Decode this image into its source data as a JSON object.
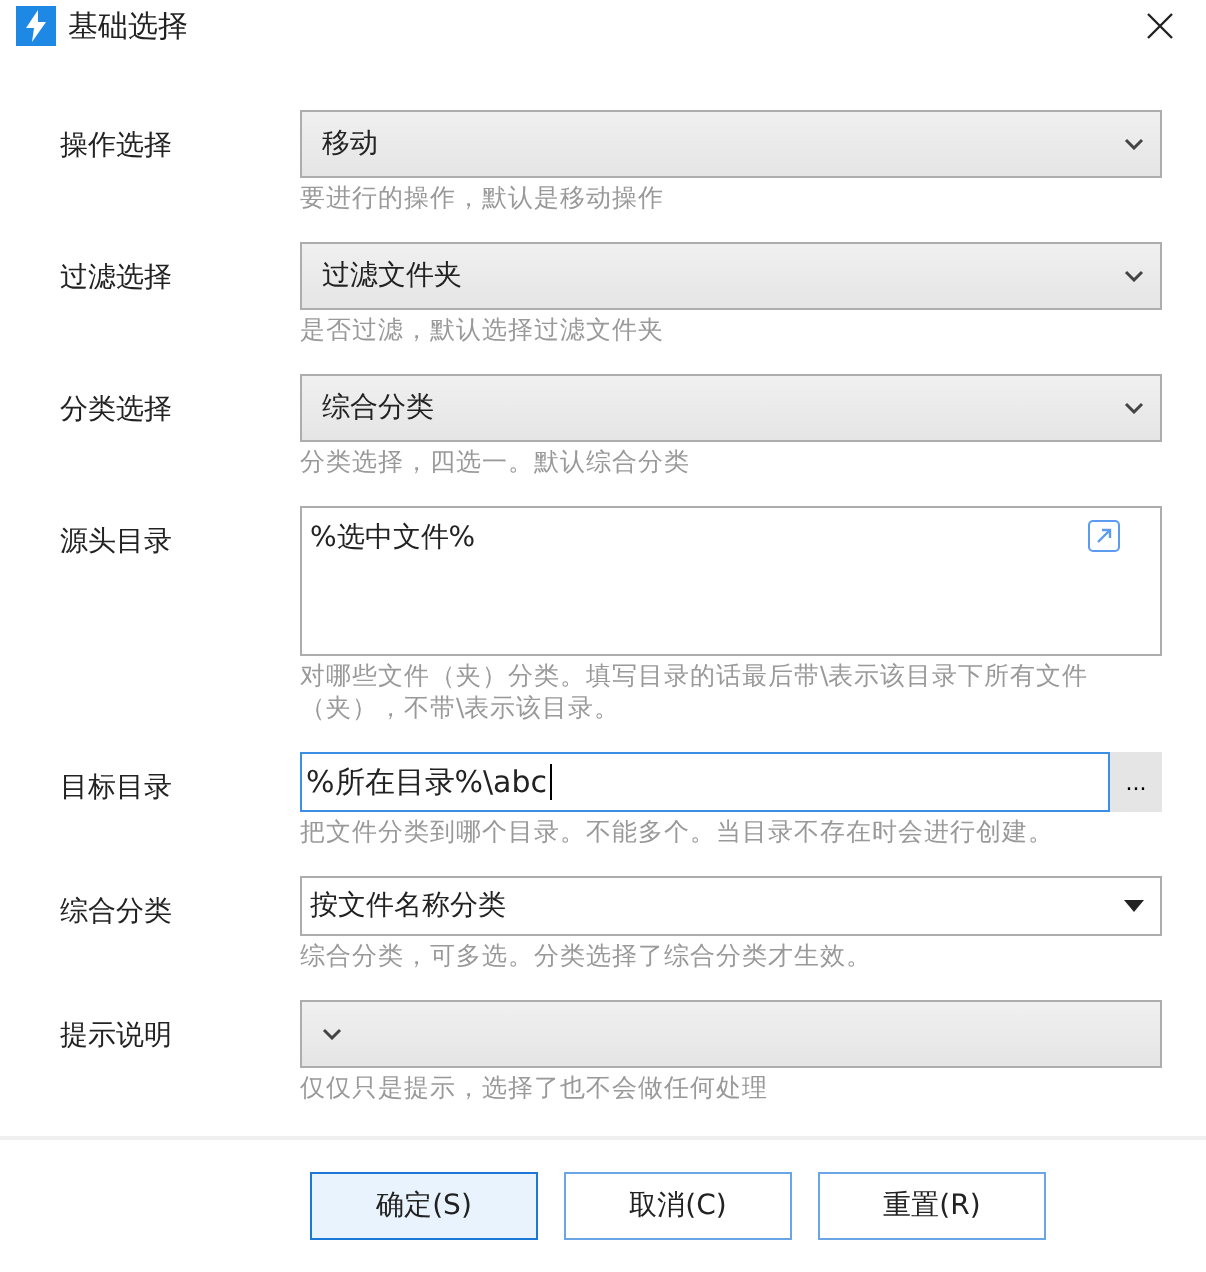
{
  "window": {
    "title": "基础选择"
  },
  "fields": [
    {
      "kind": "select",
      "label": "操作选择",
      "value": "移动",
      "hint": "要进行的操作，默认是移动操作"
    },
    {
      "kind": "select",
      "label": "过滤选择",
      "value": "过滤文件夹",
      "hint": "是否过滤，默认选择过滤文件夹"
    },
    {
      "kind": "select",
      "label": "分类选择",
      "value": "综合分类",
      "hint": "分类选择，四选一。默认综合分类"
    },
    {
      "kind": "textarea",
      "label": "源头目录",
      "value": "%选中文件%",
      "hint": "对哪些文件（夹）分类。填写目录的话最后带\\表示该目录下所有文件（夹），不带\\表示该目录。"
    },
    {
      "kind": "browse",
      "label": "目标目录",
      "value": "%所在目录%\\abc",
      "focused": true,
      "browse": "...",
      "hint": "把文件分类到哪个目录。不能多个。当目录不存在时会进行创建。"
    },
    {
      "kind": "dropdown",
      "label": "综合分类",
      "value": "按文件名称分类",
      "hint": "综合分类，可多选。分类选择了综合分类才生效。"
    },
    {
      "kind": "select",
      "label": "提示说明",
      "hint": "仅仅只是提示，选择了也不会做任何处理"
    }
  ],
  "buttons": [
    {
      "label": "确定(S)",
      "selected": true
    },
    {
      "label": "取消(C)",
      "selected": false
    },
    {
      "label": "重置(R)",
      "selected": false
    }
  ]
}
